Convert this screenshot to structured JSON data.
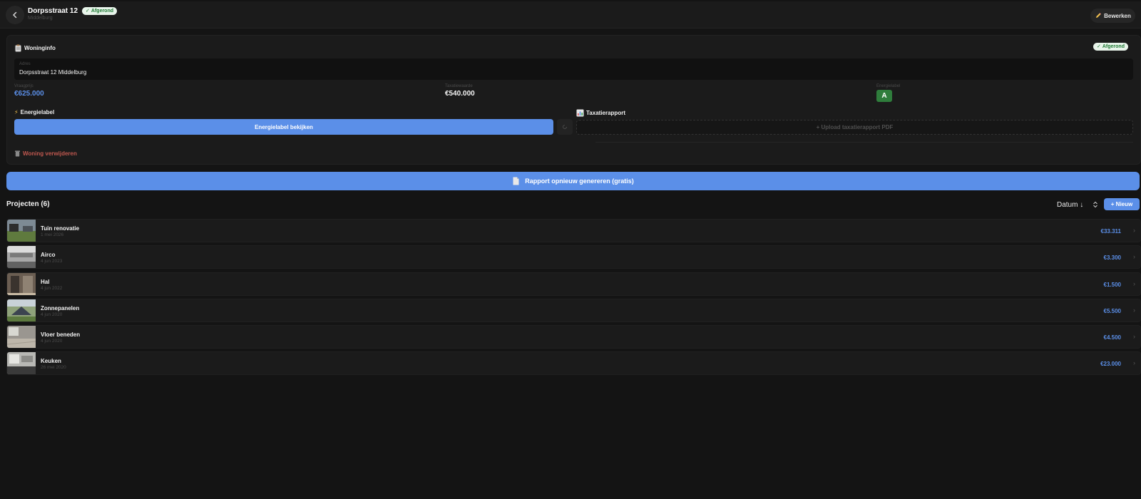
{
  "header": {
    "title": "Dorpsstraat 12",
    "status_badge": "Afgerond",
    "subtitle": "Middelburg",
    "edit_button": "Bewerken"
  },
  "woninginfo": {
    "title": "Woninginfo",
    "status_badge": "Afgerond",
    "address_label": "Adres",
    "address_value": "Dorpsstraat 12 Middelburg",
    "asking_price_label": "Vraagprijs",
    "asking_price_value": "€625.000",
    "valuation_label": "Taxatiewaarde",
    "valuation_value": "€540.000",
    "energy_label_label": "Energielabel",
    "energy_label_value": "A",
    "energy_section_title": "Energielabel",
    "energy_view_button": "Energielabel bekijken",
    "report_section_title": "Taxatierapport",
    "upload_button": "+ Upload taxatierapport PDF",
    "delete_link": "Woning verwijderen"
  },
  "regenerate_button": "Rapport opnieuw genereren (gratis)",
  "projects": {
    "title": "Projecten (6)",
    "sort_value": "Datum ↓",
    "new_button": "+ Nieuw",
    "items": [
      {
        "name": "Tuin renovatie",
        "date": "1 mei 2026",
        "amount": "€33.311"
      },
      {
        "name": "Airco",
        "date": "4 jun 2023",
        "amount": "€3.300"
      },
      {
        "name": "Hal",
        "date": "4 jun 2022",
        "amount": "€1.500"
      },
      {
        "name": "Zonnepanelen",
        "date": "4 jun 2020",
        "amount": "€5.500"
      },
      {
        "name": "Vloer beneden",
        "date": "4 jun 2020",
        "amount": "€4.500"
      },
      {
        "name": "Keuken",
        "date": "26 mei 2020",
        "amount": "€23.000"
      }
    ]
  },
  "colors": {
    "accent": "#5b8fe8",
    "success": "#2f7d3c",
    "danger": "#c0584f",
    "background": "#141414",
    "card": "#1b1b1b"
  },
  "icons": {
    "back": "chevron-left-icon",
    "edit": "pencil-icon",
    "woninginfo": "clipboard-icon",
    "energy": "lightning-icon",
    "report": "bar-chart-icon",
    "delete": "trash-icon",
    "regenerate": "document-icon",
    "sort": "sort-arrows-icon",
    "row": "chevron-right-icon"
  }
}
